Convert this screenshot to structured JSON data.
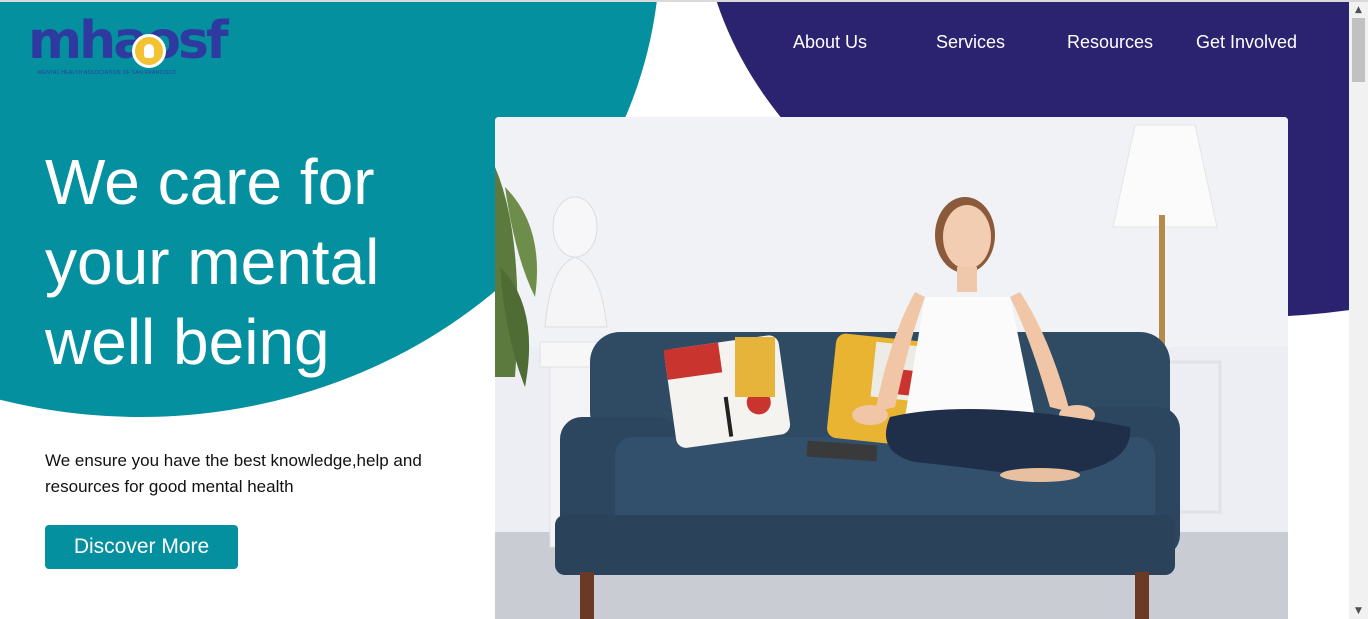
{
  "brand": {
    "logo_text": "mhaosf",
    "logo_subtitle": "MENTAL HEALTH ASSOCIATION OF SAN FRANCISCO"
  },
  "nav": {
    "items": [
      {
        "label": "About Us"
      },
      {
        "label": "Services"
      },
      {
        "label": "Resources"
      },
      {
        "label": "Get Involved"
      }
    ]
  },
  "hero": {
    "title_lines": [
      "We care for",
      "your mental",
      "well being"
    ],
    "subtitle": "We ensure you have the best knowledge,help and resources for good mental health",
    "cta_label": "Discover More"
  },
  "colors": {
    "teal": "#05909f",
    "navy": "#2b2370",
    "logo_blue": "#2e3aa0",
    "logo_gold": "#f2c233"
  },
  "icons": {
    "scroll_up": "▲",
    "scroll_down": "▼"
  }
}
